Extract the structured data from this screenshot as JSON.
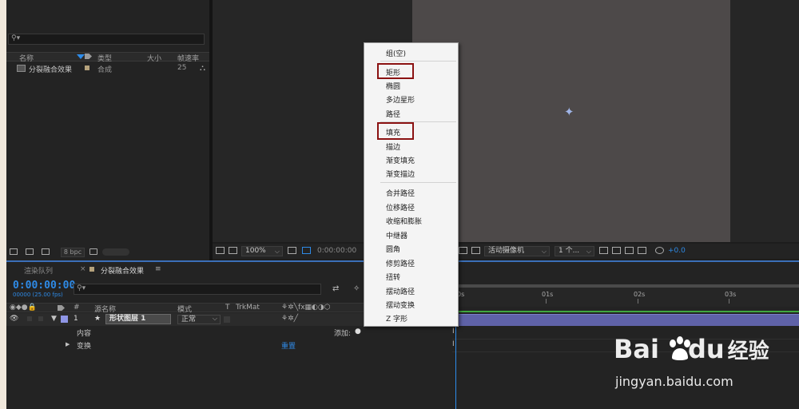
{
  "project": {
    "search_placeholder": "",
    "columns": {
      "name": "名称",
      "type": "类型",
      "size": "大小",
      "fps": "帧速率"
    },
    "items": [
      {
        "name": "分裂融合效果",
        "type": "合成",
        "fps": "25"
      }
    ],
    "bpc": "8 bpc"
  },
  "viewer": {
    "zoom": "100%",
    "timecode": "0:00:00:00",
    "camera": "活动摄像机",
    "views": "1 个...",
    "exposure": "+0.0"
  },
  "timeline": {
    "tabs": {
      "render_queue": "渲染队列",
      "comp": "分裂融合效果"
    },
    "timecode": "0:00:00:00",
    "timecode_sub": "00000 (25.00 fps)",
    "columns": {
      "num": "#",
      "source": "源名称",
      "mode": "模式",
      "t": "T",
      "trkmat": "TrkMat"
    },
    "layer": {
      "num": "1",
      "name": "形状图层 1",
      "mode": "正常"
    },
    "content_label": "内容",
    "add_label": "添加:",
    "transform_label": "变换",
    "reset_label": "重置",
    "ruler": [
      "0s",
      "01s",
      "02s",
      "03s"
    ]
  },
  "context_menu": {
    "group1": [
      "组(空)"
    ],
    "group2": [
      "矩形",
      "椭圆",
      "多边星形",
      "路径"
    ],
    "group3": [
      "填充",
      "描边",
      "渐变填充",
      "渐变描边"
    ],
    "group4": [
      "合并路径",
      "位移路径",
      "收缩和膨胀",
      "中继器",
      "圆角",
      "修剪路径",
      "扭转",
      "摆动路径",
      "摆动变换",
      "Z 字形"
    ]
  },
  "watermark": {
    "logo_left": "Bai",
    "logo_right": "du",
    "logo_cn": "经验",
    "url": "jingyan.baidu.com"
  },
  "colors": {
    "accent": "#2e8ae6",
    "highlight": "#8b1212",
    "layer_bar": "#5f62a8",
    "label_blue": "#8f96e6"
  }
}
